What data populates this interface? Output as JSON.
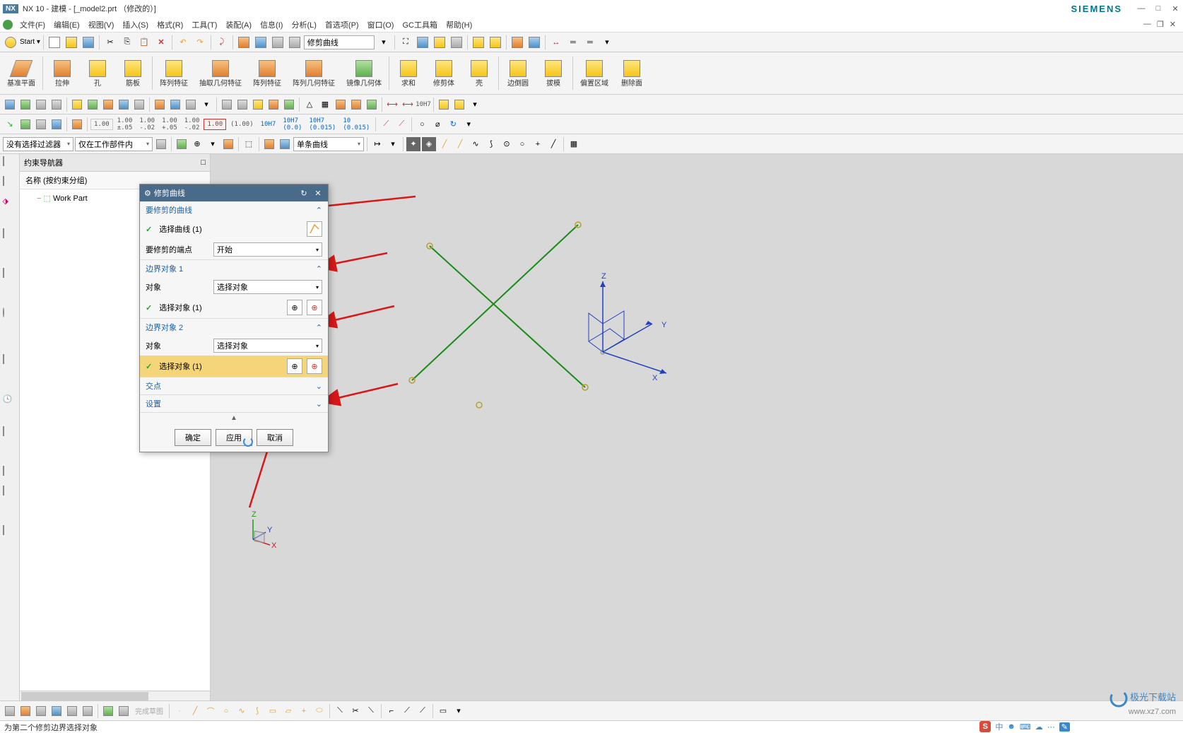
{
  "title": "NX 10 - 建模 - [_model2.prt （修改的）]",
  "brand_right": "SIEMENS",
  "menu": [
    "文件(F)",
    "编辑(E)",
    "视图(V)",
    "插入(S)",
    "格式(R)",
    "工具(T)",
    "装配(A)",
    "信息(I)",
    "分析(L)",
    "首选项(P)",
    "窗口(O)",
    "GC工具箱",
    "帮助(H)"
  ],
  "start_label": "Start ▾",
  "search_box": "修剪曲线",
  "ribbon": [
    "基准平面",
    "拉伸",
    "孔",
    "筋板",
    "阵列特征",
    "抽取几何特征",
    "阵列特征",
    "阵列几何特征",
    "镜像几何体",
    "求和",
    "修剪体",
    "壳",
    "边倒圆",
    "拔模",
    "偏置区域",
    "删除面"
  ],
  "dim_labels": [
    "1.00",
    "1.00\n±.05",
    "1.00\n-.02",
    "1.00\n+.05",
    "1.00\n-.02",
    "1.00",
    "(1.00)",
    "10H7",
    "10H7\n(0.0)",
    "10H7\n(0.015)",
    "10\n(0.015)"
  ],
  "filter1": "没有选择过滤器",
  "filter2": "仅在工作部件内",
  "filter3": "单条曲线",
  "nav": {
    "title": "约束导航器",
    "col": "名称 (按约束分组)",
    "tree_root": "Work Part"
  },
  "dialog": {
    "title": "修剪曲线",
    "section1": "要修剪的曲线",
    "row1_label": "选择曲线 (1)",
    "row2_label": "要修剪的端点",
    "row2_value": "开始",
    "section2": "边界对象 1",
    "obj_label": "对象",
    "obj_value": "选择对象",
    "sel_label2": "选择对象 (1)",
    "section3": "边界对象 2",
    "sel_label3": "选择对象 (1)",
    "section4": "交点",
    "section5": "设置",
    "btn_ok": "确定",
    "btn_apply": "应用",
    "btn_cancel": "取消"
  },
  "status": "为第二个修剪边界选择对象",
  "coord": {
    "x": "X",
    "y": "Y",
    "z": "Z"
  },
  "watermark": {
    "brand": "极光下载站",
    "url": "www.xz7.com"
  },
  "ime": [
    "中",
    "ㆍ",
    "⌨",
    "☺",
    "…"
  ],
  "completed": "完成草图"
}
